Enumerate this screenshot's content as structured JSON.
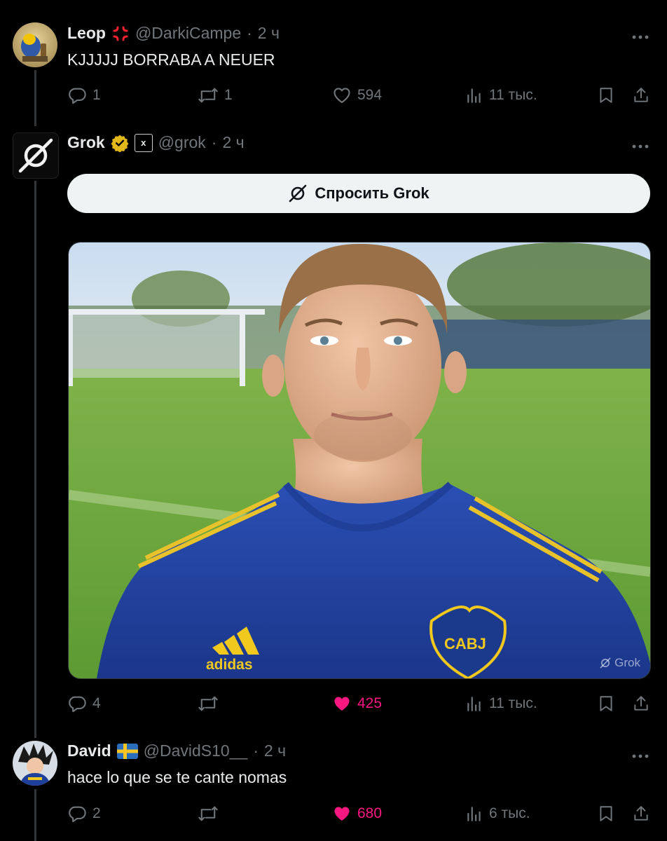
{
  "posts": [
    {
      "name": "Leop",
      "handle": "@DarkiCampe",
      "sep": "·",
      "time": "2 ч",
      "text": "KJJJJJ BORRABA A NEUER",
      "replies": "1",
      "reposts": "1",
      "likes": "594",
      "views": "11 тыс.",
      "liked": false,
      "badge_icon": "anger-symbol-icon"
    },
    {
      "name": "Grok",
      "handle": "@grok",
      "sep": "·",
      "time": "2 ч",
      "ask_button": "Спросить Grok",
      "image_watermark": "Grok",
      "jersey_brand": "adidas",
      "crest_text": "CABJ",
      "replies": "4",
      "reposts": "",
      "likes": "425",
      "views": "11 тыс.",
      "liked": true,
      "badge_x": "x",
      "badge_icon": "verified-gold-icon"
    },
    {
      "name": "David",
      "handle": "@DavidS10__",
      "sep": "·",
      "time": "2 ч",
      "text": "hace lo que se te cante nomas",
      "replies": "2",
      "reposts": "",
      "likes": "680",
      "views": "6 тыс.",
      "liked": true,
      "badge_icon": "sweden-flag-icon"
    }
  ],
  "colors": {
    "background": "#000000",
    "text": "#e7e9ea",
    "muted": "#71767b",
    "like": "#f91880",
    "gold_badge": "#e2b719",
    "button_bg": "#eff3f4"
  }
}
